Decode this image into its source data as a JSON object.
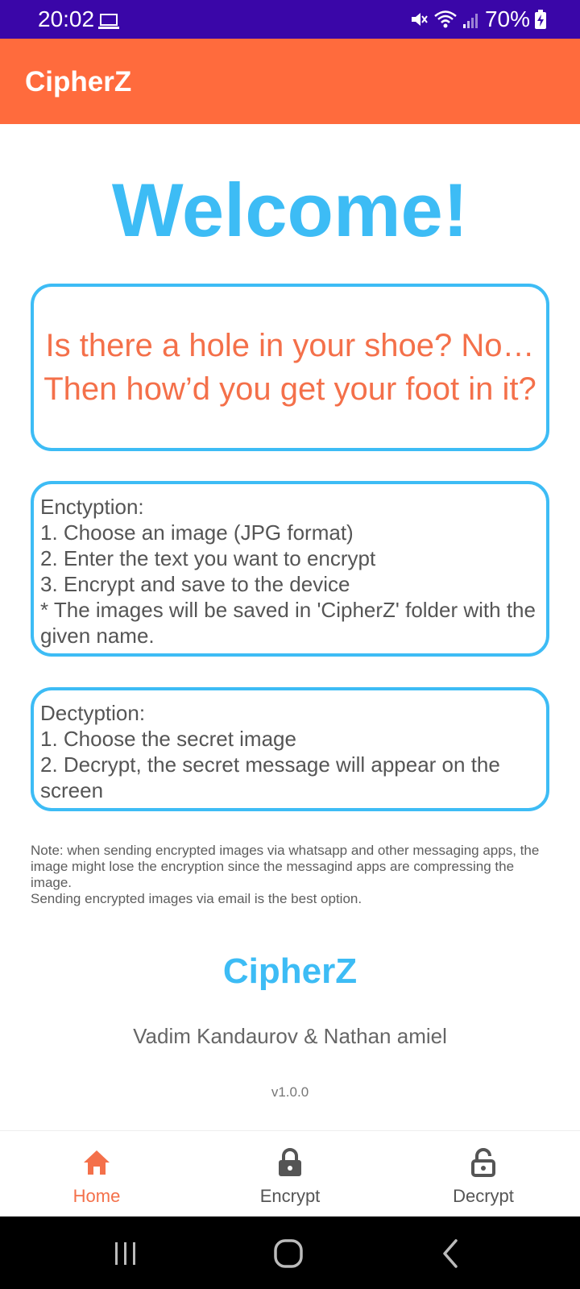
{
  "status_bar": {
    "time": "20:02",
    "battery": "70%",
    "icons": [
      "laptop-icon",
      "mute-icon",
      "wifi-icon",
      "signal-icon",
      "battery-charging-icon"
    ]
  },
  "app_bar": {
    "title": "CipherZ"
  },
  "welcome": "Welcome!",
  "joke": "Is there a hole in your shoe? No… Then how’d you get your foot in it?",
  "encryption": {
    "title": "Enctyption:",
    "lines": [
      "1. Choose an image (JPG format)",
      "2. Enter the text you want to encrypt",
      "3. Encrypt and save to the device",
      "* The images will be saved in 'CipherZ' folder with the given name."
    ]
  },
  "decryption": {
    "title": "Dectyption:",
    "lines": [
      "1. Choose the secret image",
      "2. Decrypt, the secret message will  appear on the screen"
    ]
  },
  "note": {
    "line1": "Note: when sending encrypted images via whatsapp and other messaging apps, the image might lose the encryption since the messagind apps are compressing the image.",
    "line2": "Sending encrypted images via email is the best option."
  },
  "footer": {
    "title": "CipherZ",
    "authors": "Vadim Kandaurov & Nathan amiel",
    "version": "v1.0.0"
  },
  "bottom_nav": {
    "items": [
      {
        "label": "Home",
        "icon": "home-icon",
        "active": true
      },
      {
        "label": "Encrypt",
        "icon": "lock-icon",
        "active": false
      },
      {
        "label": "Decrypt",
        "icon": "unlock-icon",
        "active": false
      }
    ]
  },
  "colors": {
    "status_bar": "#3a06a8",
    "app_bar": "#ff6b3d",
    "accent_blue": "#3dbcf5",
    "accent_orange": "#f4704a"
  }
}
